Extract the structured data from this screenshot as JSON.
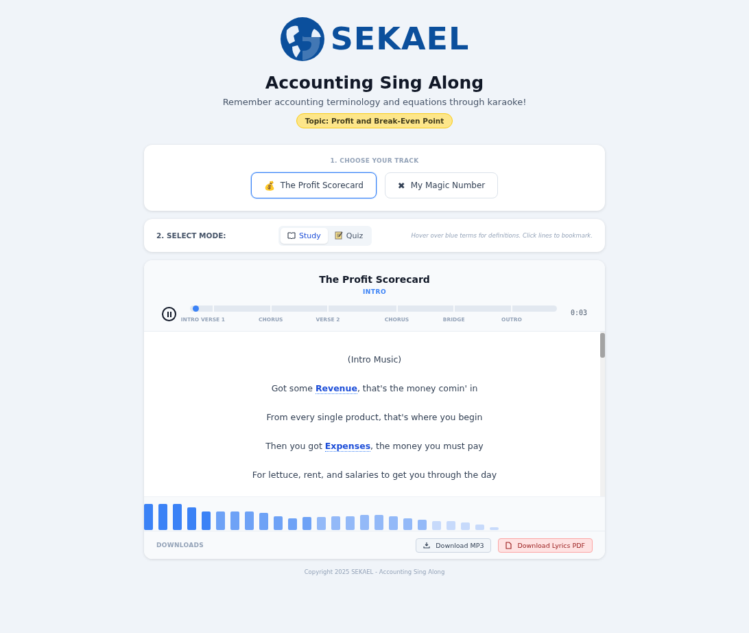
{
  "brand": {
    "name": "SEKAEL"
  },
  "title": "Accounting Sing Along",
  "subtitle": "Remember accounting terminology and equations through karaoke!",
  "topic": "Topic: Profit and Break-Even Point",
  "track_picker": {
    "heading": "1. CHOOSE YOUR TRACK",
    "tracks": [
      {
        "label": "The Profit Scorecard",
        "icon": "💰",
        "selected": true
      },
      {
        "label": "My Magic Number",
        "icon": "✖",
        "selected": false
      }
    ]
  },
  "mode_bar": {
    "heading": "2. SELECT MODE:",
    "modes": [
      {
        "label": "Study",
        "kind": "book",
        "selected": true
      },
      {
        "label": "Quiz",
        "kind": "memo",
        "selected": false
      }
    ],
    "hint": "Hover over blue terms for definitions. Click lines to bookmark."
  },
  "player": {
    "title": "The Profit Scorecard",
    "section": "INTRO",
    "playing": true,
    "level": 0.01,
    "time": "0:03",
    "sections": [
      "INTRO",
      "VERSE 1",
      "CHORUS",
      "VERSE 2",
      "CHORUS",
      "BRIDGE",
      "OUTRO"
    ]
  },
  "lyrics": [
    [
      {
        "kind": "plain",
        "text": "(Intro Music)"
      }
    ],
    [
      {
        "kind": "plain",
        "text": "Got some "
      },
      {
        "kind": "term",
        "text": "Revenue"
      },
      {
        "kind": "plain",
        "text": ", that's the money comin' in"
      }
    ],
    [
      {
        "kind": "plain",
        "text": "From every single product, that's where you begin"
      }
    ],
    [
      {
        "kind": "plain",
        "text": "Then you got "
      },
      {
        "kind": "term",
        "text": "Expenses"
      },
      {
        "kind": "plain",
        "text": ", the money you must pay"
      }
    ],
    [
      {
        "kind": "plain",
        "text": "For lettuce, rent, and salaries to get you through the day"
      }
    ]
  ],
  "downloads": {
    "heading": "DOWNLOADS",
    "buttons": [
      {
        "label": "Download MP3",
        "kind": "mp3"
      },
      {
        "label": "Download Lyrics PDF",
        "kind": "pdf"
      }
    ]
  },
  "footer": "Copyright 2025 SEKAEL - Accounting Sing Along"
}
